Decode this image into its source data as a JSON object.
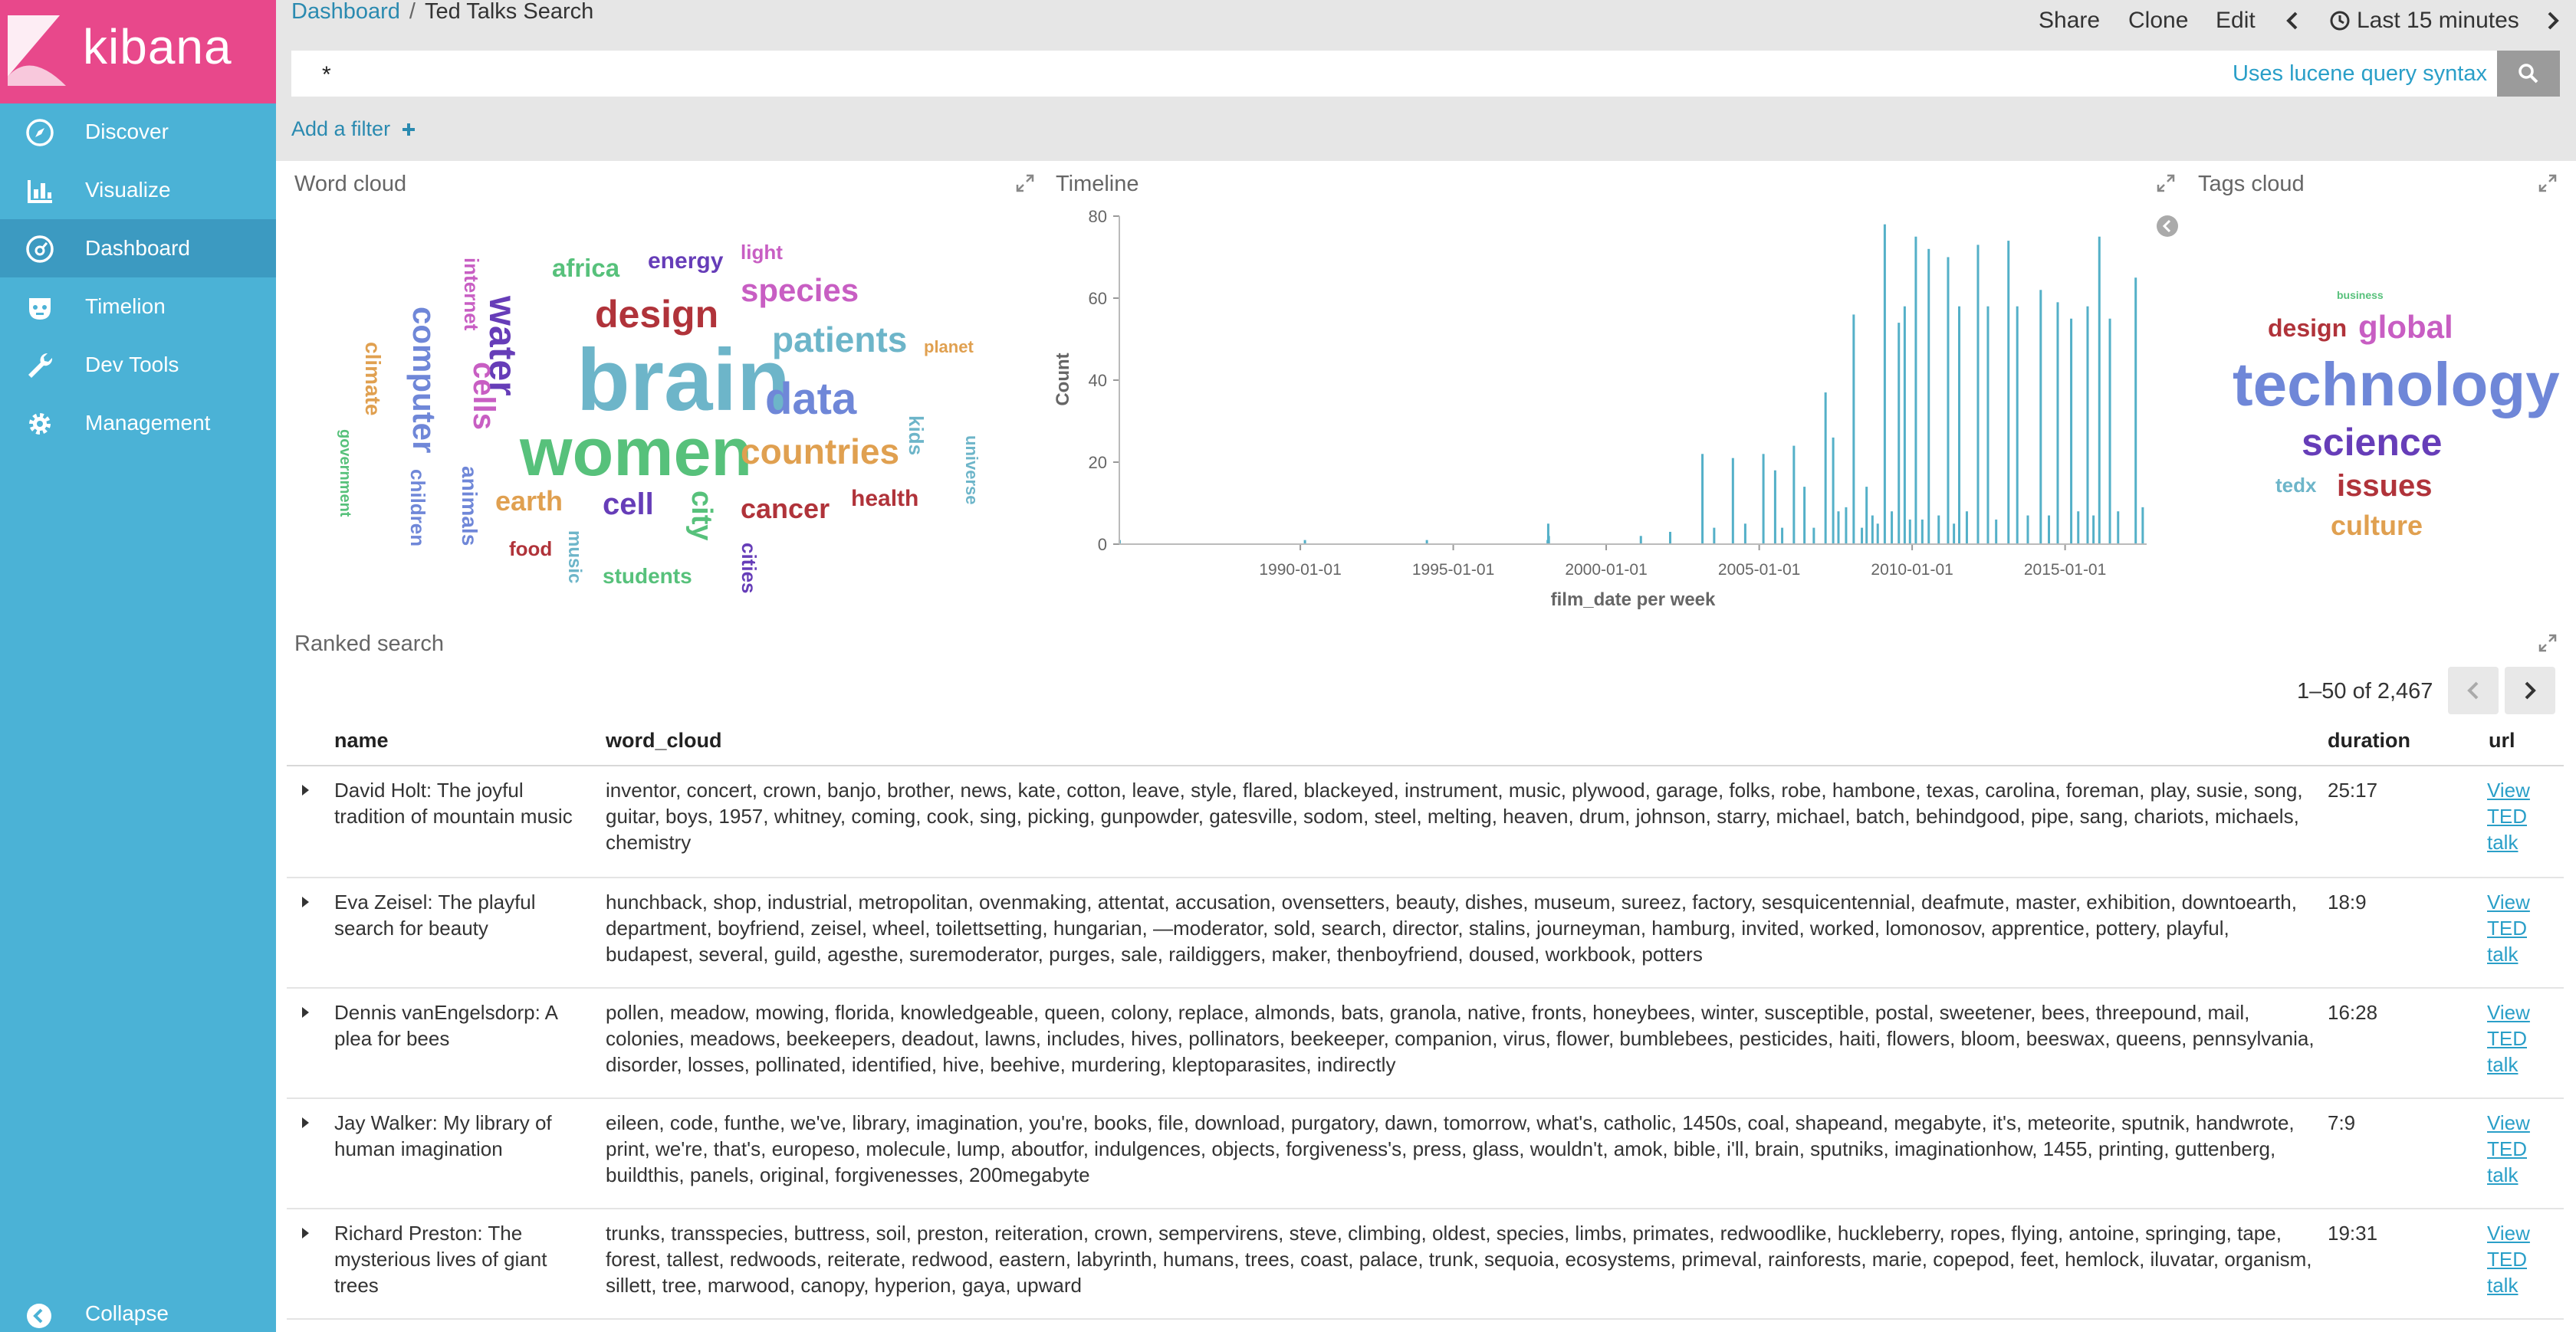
{
  "app": {
    "logo_text": "kibana"
  },
  "sidebar": {
    "items": [
      {
        "label": "Discover",
        "icon": "compass-icon"
      },
      {
        "label": "Visualize",
        "icon": "bar-chart-icon"
      },
      {
        "label": "Dashboard",
        "icon": "dashboard-icon",
        "active": true
      },
      {
        "label": "Timelion",
        "icon": "timelion-icon"
      },
      {
        "label": "Dev Tools",
        "icon": "wrench-icon"
      },
      {
        "label": "Management",
        "icon": "gear-icon"
      }
    ],
    "collapse_label": "Collapse"
  },
  "header": {
    "breadcrumb_link": "Dashboard",
    "breadcrumb_sep": "/",
    "title": "Ted Talks Search",
    "share": "Share",
    "clone": "Clone",
    "edit": "Edit",
    "time_range": "Last 15 minutes"
  },
  "query": {
    "value": "*",
    "hint": "Uses lucene query syntax"
  },
  "filters": {
    "add_filter": "Add a filter"
  },
  "panels": {
    "word_cloud": {
      "title": "Word cloud",
      "words": [
        {
          "text": "brain",
          "color": "#6db5c9"
        },
        {
          "text": "women",
          "color": "#57c17b"
        },
        {
          "text": "design",
          "color": "#b0333a"
        },
        {
          "text": "species",
          "color": "#c85ec3"
        },
        {
          "text": "patients",
          "color": "#6db5c9"
        },
        {
          "text": "data",
          "color": "#6f87d8"
        },
        {
          "text": "countries",
          "color": "#e0a050"
        },
        {
          "text": "water",
          "color": "#663db8"
        },
        {
          "text": "computer",
          "color": "#6f87d8"
        },
        {
          "text": "cells",
          "color": "#c85ec3"
        },
        {
          "text": "africa",
          "color": "#57c17b"
        },
        {
          "text": "energy",
          "color": "#663db8"
        },
        {
          "text": "light",
          "color": "#c85ec3"
        },
        {
          "text": "planet",
          "color": "#e0a050"
        },
        {
          "text": "internet",
          "color": "#c85ec3"
        },
        {
          "text": "climate",
          "color": "#e0a050"
        },
        {
          "text": "earth",
          "color": "#e0a050"
        },
        {
          "text": "cell",
          "color": "#663db8"
        },
        {
          "text": "city",
          "color": "#57c17b"
        },
        {
          "text": "cancer",
          "color": "#b0333a"
        },
        {
          "text": "health",
          "color": "#b0333a"
        },
        {
          "text": "kids",
          "color": "#6db5c9"
        },
        {
          "text": "universe",
          "color": "#6db5c9"
        },
        {
          "text": "government",
          "color": "#57c17b"
        },
        {
          "text": "children",
          "color": "#6f87d8"
        },
        {
          "text": "animals",
          "color": "#6f87d8"
        },
        {
          "text": "food",
          "color": "#b0333a"
        },
        {
          "text": "music",
          "color": "#6db5c9"
        },
        {
          "text": "students",
          "color": "#57c17b"
        },
        {
          "text": "cities",
          "color": "#663db8"
        }
      ]
    },
    "timeline": {
      "title": "Timeline",
      "chart_data": {
        "type": "bar",
        "title": "",
        "xlabel": "film_date per week",
        "ylabel": "Count",
        "ylim": [
          0,
          80
        ],
        "yticks": [
          0,
          20,
          40,
          60,
          80
        ],
        "xticks": [
          "1990-01-01",
          "1995-01-01",
          "2000-01-01",
          "2005-01-01",
          "2010-01-01",
          "2015-01-01"
        ],
        "color": "#54b0c8",
        "x_start": "1984-02-01",
        "x_end": "2017-09-01",
        "bars": [
          {
            "x": "1984-02-05",
            "y": 1
          },
          {
            "x": "1990-02-25",
            "y": 1
          },
          {
            "x": "1994-02-20",
            "y": 1
          },
          {
            "x": "1998-02-01",
            "y": 1
          },
          {
            "x": "1998-02-08",
            "y": 5
          },
          {
            "x": "1998-02-15",
            "y": 2
          },
          {
            "x": "2001-02-18",
            "y": 2
          },
          {
            "x": "2002-02-03",
            "y": 3
          },
          {
            "x": "2003-02-23",
            "y": 22
          },
          {
            "x": "2003-07-13",
            "y": 4
          },
          {
            "x": "2004-02-22",
            "y": 21
          },
          {
            "x": "2004-07-18",
            "y": 5
          },
          {
            "x": "2005-02-20",
            "y": 22
          },
          {
            "x": "2005-07-10",
            "y": 18
          },
          {
            "x": "2005-10-02",
            "y": 4
          },
          {
            "x": "2006-02-19",
            "y": 24
          },
          {
            "x": "2006-06-25",
            "y": 14
          },
          {
            "x": "2006-10-15",
            "y": 4
          },
          {
            "x": "2007-03-04",
            "y": 37
          },
          {
            "x": "2007-06-03",
            "y": 26
          },
          {
            "x": "2007-08-05",
            "y": 8
          },
          {
            "x": "2007-11-04",
            "y": 9
          },
          {
            "x": "2008-02-03",
            "y": 56
          },
          {
            "x": "2008-05-11",
            "y": 4
          },
          {
            "x": "2008-07-06",
            "y": 14
          },
          {
            "x": "2008-09-14",
            "y": 7
          },
          {
            "x": "2008-11-16",
            "y": 5
          },
          {
            "x": "2009-02-08",
            "y": 78
          },
          {
            "x": "2009-05-03",
            "y": 8
          },
          {
            "x": "2009-07-26",
            "y": 54
          },
          {
            "x": "2009-10-04",
            "y": 58
          },
          {
            "x": "2009-12-06",
            "y": 6
          },
          {
            "x": "2010-02-14",
            "y": 75
          },
          {
            "x": "2010-05-02",
            "y": 6
          },
          {
            "x": "2010-07-18",
            "y": 72
          },
          {
            "x": "2010-11-14",
            "y": 7
          },
          {
            "x": "2011-03-06",
            "y": 70
          },
          {
            "x": "2011-05-15",
            "y": 5
          },
          {
            "x": "2011-07-17",
            "y": 58
          },
          {
            "x": "2011-10-16",
            "y": 8
          },
          {
            "x": "2012-02-26",
            "y": 73
          },
          {
            "x": "2012-06-24",
            "y": 58
          },
          {
            "x": "2012-09-30",
            "y": 6
          },
          {
            "x": "2013-02-24",
            "y": 74
          },
          {
            "x": "2013-06-09",
            "y": 58
          },
          {
            "x": "2013-10-13",
            "y": 7
          },
          {
            "x": "2014-03-16",
            "y": 62
          },
          {
            "x": "2014-06-22",
            "y": 7
          },
          {
            "x": "2014-10-05",
            "y": 59
          },
          {
            "x": "2015-03-15",
            "y": 55
          },
          {
            "x": "2015-06-07",
            "y": 8
          },
          {
            "x": "2015-09-27",
            "y": 58
          },
          {
            "x": "2015-12-06",
            "y": 7
          },
          {
            "x": "2016-02-14",
            "y": 75
          },
          {
            "x": "2016-06-19",
            "y": 55
          },
          {
            "x": "2016-09-25",
            "y": 8
          },
          {
            "x": "2017-04-23",
            "y": 65
          },
          {
            "x": "2017-07-16",
            "y": 9
          }
        ]
      }
    },
    "tags_cloud": {
      "title": "Tags cloud",
      "words": [
        {
          "text": "business",
          "color": "#57c17b"
        },
        {
          "text": "design",
          "color": "#b0333a"
        },
        {
          "text": "global",
          "color": "#c85ec3"
        },
        {
          "text": "technology",
          "color": "#6f87d8"
        },
        {
          "text": "science",
          "color": "#663db8"
        },
        {
          "text": "tedx",
          "color": "#6db5c9"
        },
        {
          "text": "issues",
          "color": "#b0333a"
        },
        {
          "text": "culture",
          "color": "#e0a050"
        }
      ]
    }
  },
  "ranked": {
    "title": "Ranked search",
    "pager": "1–50 of 2,467",
    "columns": {
      "name": "name",
      "word_cloud": "word_cloud",
      "duration": "duration",
      "url": "url"
    },
    "rows": [
      {
        "name": "David Holt: The joyful tradition of mountain music",
        "word_cloud": "inventor, concert, crown, banjo, brother, news, kate, cotton, leave, style, flared, blackeyed, instrument, music, plywood, garage, folks, robe, hambone, texas, carolina, foreman, play, susie, song, guitar, boys, 1957, whitney, coming, cook, sing, picking, gunpowder, gatesville, sodom, steel, melting, heaven, drum, johnson, starry, michael, batch, behindgood, pipe, sang, chariots, michaels, chemistry",
        "duration": "25:17",
        "url": "View TED talk"
      },
      {
        "name": "Eva Zeisel: The playful search for beauty",
        "word_cloud": "hunchback, shop, industrial, metropolitan, ovenmaking, attentat, accusation, ovensetters, beauty, dishes, museum, sureez, factory, sesquicentennial, deafmute, master, exhibition, downtoearth, department, boyfriend, zeisel, wheel, toilettsetting, hungarian, —moderator, sold, search, director, stalins, journeyman, hamburg, invited, worked, lomonosov, apprentice, pottery, playful, budapest, several, guild, agesthe, suremoderator, purges, sale, raildiggers, maker, thenboyfriend, doused, workbook, potters",
        "duration": "18:9",
        "url": "View TED talk"
      },
      {
        "name": "Dennis vanEngelsdorp: A plea for bees",
        "word_cloud": "pollen, meadow, mowing, florida, knowledgeable, queen, colony, replace, almonds, bats, granola, native, fronts, honeybees, winter, susceptible, postal, sweetener, bees, threepound, mail, colonies, meadows, beekeepers, deadout, lawns, includes, hives, pollinators, beekeeper, companion, virus, flower, bumblebees, pesticides, haiti, flowers, bloom, beeswax, queens, pennsylvania, disorder, losses, pollinated, identified, hive, beehive, murdering, kleptoparasites, indirectly",
        "duration": "16:28",
        "url": "View TED talk"
      },
      {
        "name": "Jay Walker: My library of human imagination",
        "word_cloud": "eileen, code, funthe, we've, library, imagination, you're, books, file, download, purgatory, dawn, tomorrow, what's, catholic, 1450s, coal, shapeand, megabyte, it's, meteorite, sputnik, handwrote, print, we're, that's, europeso, molecule, lump, aboutfor, indulgences, objects, forgiveness's, press, glass, wouldn't, amok, bible, i'll, brain, sputniks, imaginationhow, 1455, printing, guttenberg, buildthis, panels, original, forgivenesses, 200megabyte",
        "duration": "7:9",
        "url": "View TED talk"
      },
      {
        "name": "Richard Preston: The mysterious lives of giant trees",
        "word_cloud": "trunks, transspecies, buttress, soil, preston, reiteration, crown, sempervirens, steve, climbing, oldest, species, limbs, primates, redwoodlike, huckleberry, ropes, flying, antoine, springing, tape, forest, tallest, redwoods, reiterate, redwood, eastern, labyrinth, humans, trees, coast, palace, trunk, sequoia, ecosystems, primeval, rainforests, marie, copepod, feet, hemlock, iluvatar, organism, sillett, tree, marwood, canopy, hyperion, gaya, upward",
        "duration": "19:31",
        "url": "View TED talk"
      }
    ]
  }
}
